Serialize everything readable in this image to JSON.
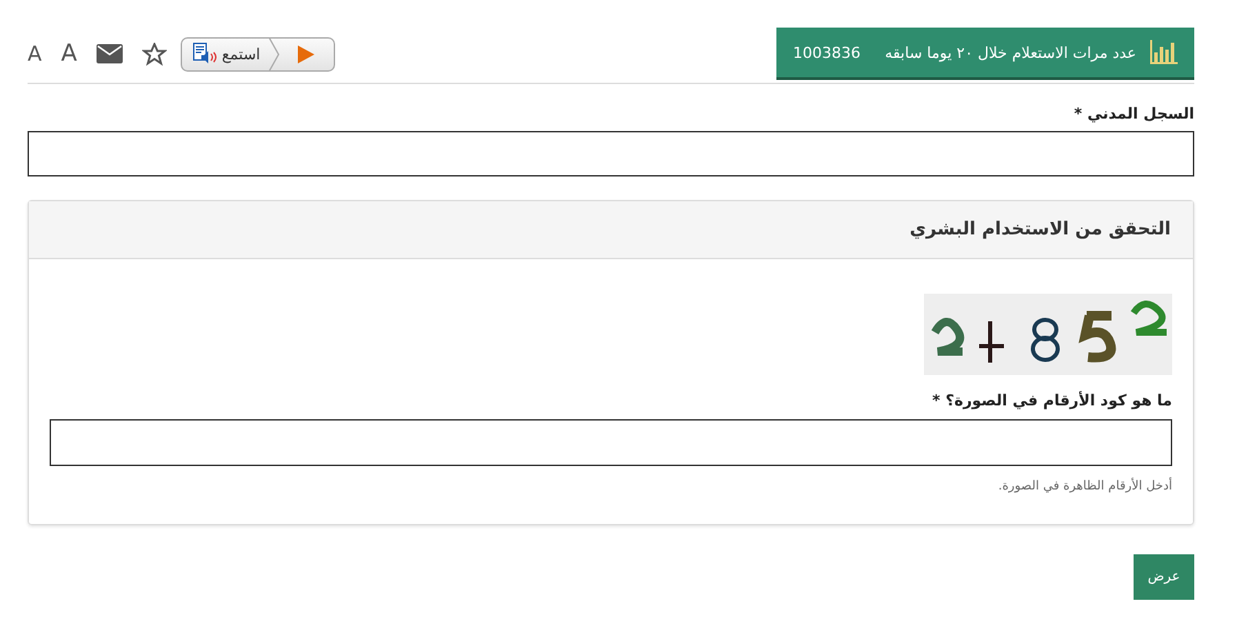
{
  "stats": {
    "label": "عدد مرات الاستعلام خلال ٢٠ يوما سابقه",
    "count": "1003836"
  },
  "toolbar": {
    "listen_button": "استمع",
    "font_buttons": [
      "A",
      "A"
    ]
  },
  "civil_record": {
    "label": "السجل المدني *"
  },
  "verification": {
    "title": "التحقق من الاستخدام البشري",
    "question": "ما هو كود الأرقام في الصورة؟ *",
    "hint": "أدخل الأرقام الظاهرة في الصورة."
  },
  "submit_button": "عرض"
}
